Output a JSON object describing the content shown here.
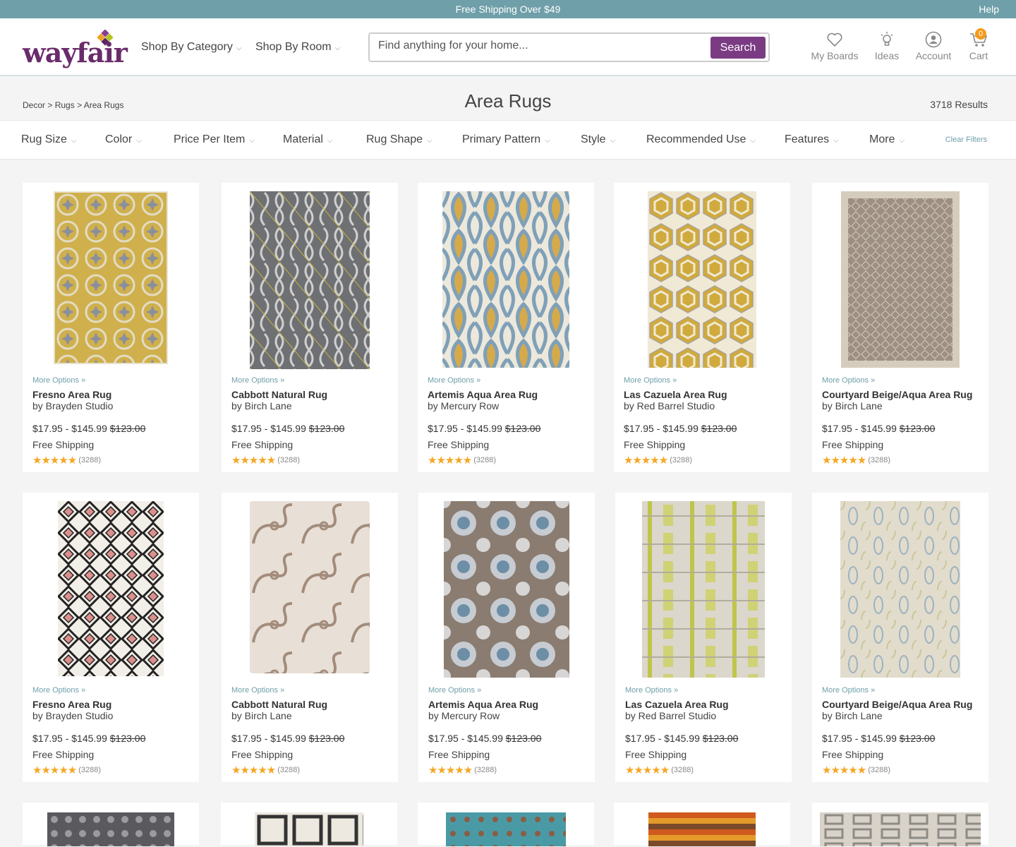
{
  "topbar": {
    "promo": "Free Shipping Over $49",
    "help": "Help"
  },
  "header": {
    "logo": "wayfair",
    "nav": [
      {
        "label": "Shop By Category"
      },
      {
        "label": "Shop By Room"
      }
    ],
    "search": {
      "placeholder": "Find anything for your home...",
      "button": "Search"
    },
    "icons": [
      {
        "label": "My Boards",
        "icon": "heart-icon"
      },
      {
        "label": "Ideas",
        "icon": "lightbulb-icon"
      },
      {
        "label": "Account",
        "icon": "account-icon"
      },
      {
        "label": "Cart",
        "icon": "cart-icon"
      }
    ],
    "cart_count": "0"
  },
  "breadcrumb": [
    "Decor",
    "Rugs",
    "Area Rugs"
  ],
  "title": "Area Rugs",
  "results": "3718 Results",
  "filters": [
    "Rug Size",
    "Color",
    "Price Per Item",
    "Material",
    "Rug Shape",
    "Primary Pattern",
    "Style",
    "Recommended Use",
    "Features",
    "More"
  ],
  "clear_filters": "Clear Filters",
  "product_common": {
    "more_options": "More Options »",
    "shipping": "Free Shipping",
    "stars": "★★★★★"
  },
  "products": [
    {
      "name": "Fresno Area Rug",
      "brand": "by Brayden Studio",
      "price": "$17.95 - $145.99",
      "was": "$123.00",
      "reviews": "(3288)"
    },
    {
      "name": "Cabbott Natural Rug",
      "brand": "by Birch Lane",
      "price": "$17.95 - $145.99",
      "was": "$123.00",
      "reviews": "(3288)"
    },
    {
      "name": "Artemis Aqua Area Rug",
      "brand": "by Mercury Row",
      "price": "$17.95 - $145.99",
      "was": "$123.00",
      "reviews": "(3288)"
    },
    {
      "name": "Las Cazuela Area Rug",
      "brand": "by Red Barrel Studio",
      "price": "$17.95 - $145.99",
      "was": "$123.00",
      "reviews": "(3288)"
    },
    {
      "name": "Courtyard Beige/Aqua Area Rug",
      "brand": "by Birch Lane",
      "price": "$17.95 - $145.99",
      "was": "$123.00",
      "reviews": "(3288)"
    },
    {
      "name": "Fresno Area Rug",
      "brand": "by Brayden Studio",
      "price": "$17.95 - $145.99",
      "was": "$123.00",
      "reviews": "(3288)"
    },
    {
      "name": "Cabbott Natural Rug",
      "brand": "by Birch Lane",
      "price": "$17.95 - $145.99",
      "was": "$123.00",
      "reviews": "(3288)"
    },
    {
      "name": "Artemis Aqua Area Rug",
      "brand": "by Mercury Row",
      "price": "$17.95 - $145.99",
      "was": "$123.00",
      "reviews": "(3288)"
    },
    {
      "name": "Las Cazuela Area Rug",
      "brand": "by Red Barrel Studio",
      "price": "$17.95 - $145.99",
      "was": "$123.00",
      "reviews": "(3288)"
    },
    {
      "name": "Courtyard Beige/Aqua Area Rug",
      "brand": "by Birch Lane",
      "price": "$17.95 - $145.99",
      "was": "$123.00",
      "reviews": "(3288)"
    }
  ],
  "colors": {
    "topbar": "#6f9fa9",
    "brand_purple": "#7b3b83",
    "star": "#f5a623",
    "link": "#6f9fa9"
  }
}
